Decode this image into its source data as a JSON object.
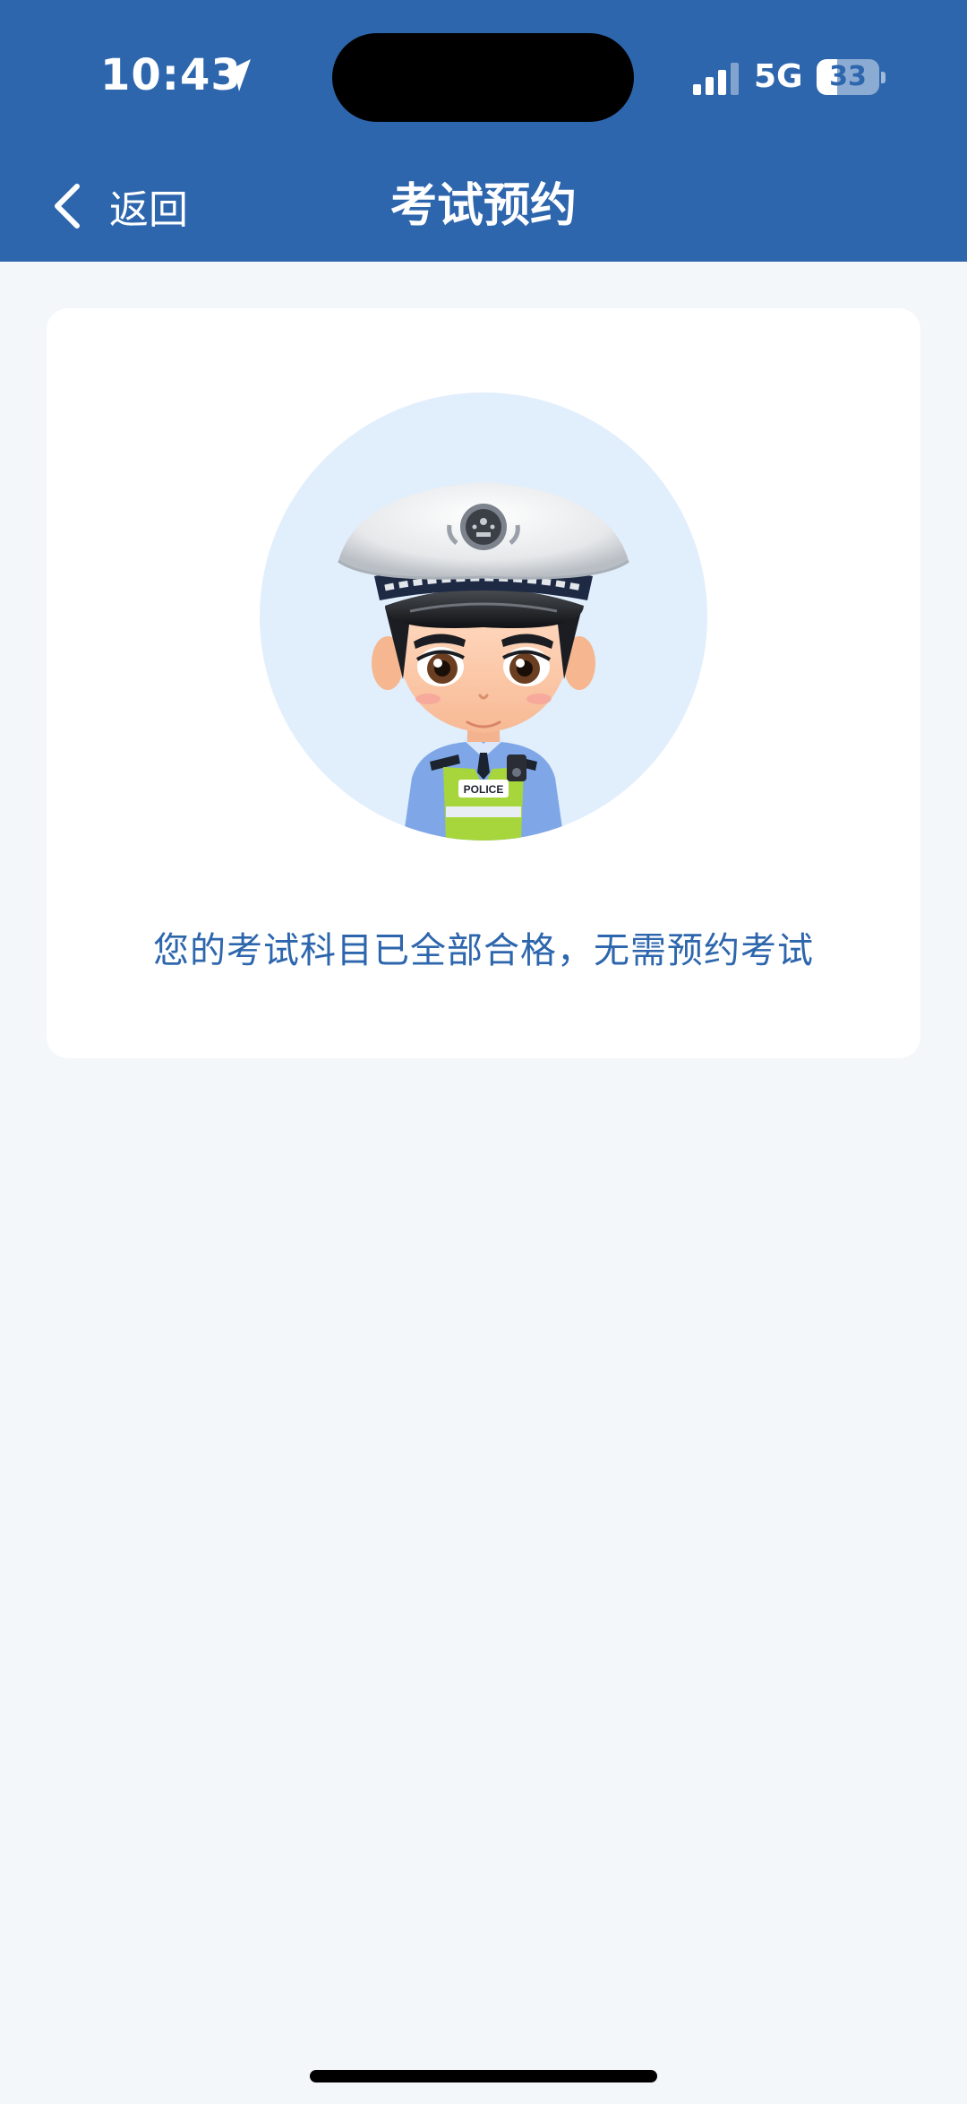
{
  "status_bar": {
    "time": "10:43",
    "network": "5G",
    "battery": "33",
    "battery_level": 0.33,
    "icons": [
      "location-arrow-icon",
      "cellular-signal-icon",
      "battery-icon"
    ]
  },
  "nav": {
    "back_label": "返回",
    "back_icon": "chevron-left-icon",
    "title": "考试预约"
  },
  "card": {
    "illustration": "police-officer-avatar",
    "badge_text": "POLICE",
    "message": "您的考试科目已全部合格，无需预约考试"
  },
  "colors": {
    "primary": "#2d66ad",
    "background": "#f3f7f9",
    "card": "#ffffff",
    "avatar_circle": "#e1eefc",
    "vest": "#a6d63b"
  }
}
